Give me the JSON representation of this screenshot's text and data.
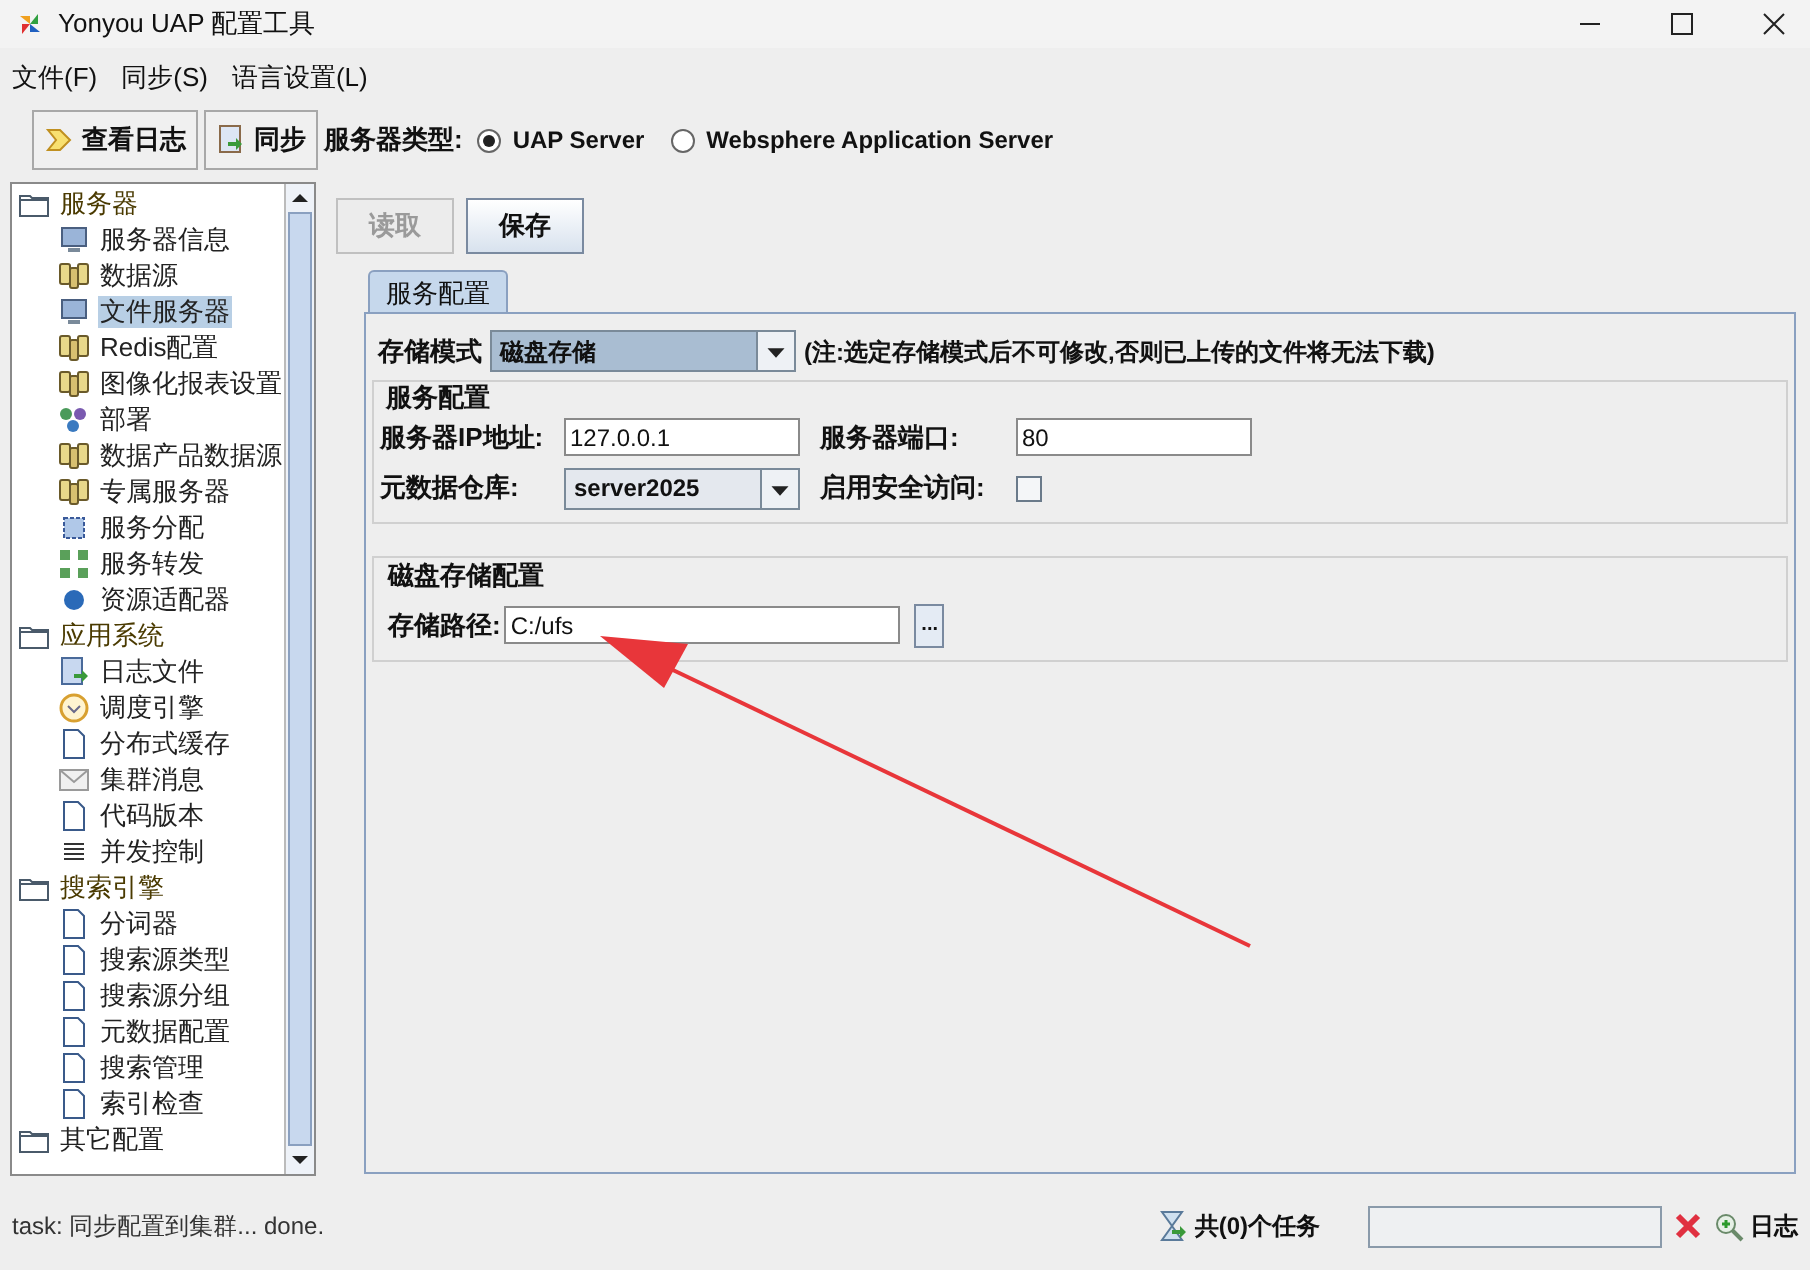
{
  "window": {
    "title": "Yonyou UAP 配置工具"
  },
  "menu": [
    {
      "label": "文件(F)"
    },
    {
      "label": "同步(S)"
    },
    {
      "label": "语言设置(L)"
    }
  ],
  "toolbar": {
    "buttons": [
      {
        "label": "查看日志",
        "kind": "log"
      },
      {
        "label": "同步",
        "kind": "sync"
      }
    ],
    "server_type_label": "服务器类型:",
    "server_types": [
      {
        "label": "UAP Server",
        "selected": true
      },
      {
        "label": "Websphere Application Server",
        "selected": false
      }
    ]
  },
  "tree": [
    {
      "label": "服务器",
      "kind": "folder",
      "selected": false,
      "children": [
        {
          "label": "服务器信息",
          "kind": "monitor",
          "selected": false
        },
        {
          "label": "数据源",
          "kind": "db",
          "selected": false
        },
        {
          "label": "文件服务器",
          "kind": "monitor",
          "selected": true
        },
        {
          "label": "Redis配置",
          "kind": "db",
          "selected": false
        },
        {
          "label": "图像化报表设置",
          "kind": "db",
          "selected": false
        },
        {
          "label": "部署",
          "kind": "people",
          "selected": false
        },
        {
          "label": "数据产品数据源",
          "kind": "db",
          "selected": false
        },
        {
          "label": "专属服务器",
          "kind": "db",
          "selected": false
        },
        {
          "label": "服务分配",
          "kind": "dist",
          "selected": false
        },
        {
          "label": "服务转发",
          "kind": "forward",
          "selected": false
        },
        {
          "label": "资源适配器",
          "kind": "ball",
          "selected": false
        }
      ]
    },
    {
      "label": "应用系统",
      "kind": "folder",
      "selected": false,
      "children": [
        {
          "label": "日志文件",
          "kind": "log",
          "selected": false
        },
        {
          "label": "调度引擎",
          "kind": "clock",
          "selected": false
        },
        {
          "label": "分布式缓存",
          "kind": "doc",
          "selected": false
        },
        {
          "label": "集群消息",
          "kind": "mail",
          "selected": false
        },
        {
          "label": "代码版本",
          "kind": "doc",
          "selected": false
        },
        {
          "label": "并发控制",
          "kind": "lines",
          "selected": false
        }
      ]
    },
    {
      "label": "搜索引擎",
      "kind": "folder",
      "selected": false,
      "children": [
        {
          "label": "分词器",
          "kind": "doc",
          "selected": false
        },
        {
          "label": "搜索源类型",
          "kind": "doc",
          "selected": false
        },
        {
          "label": "搜索源分组",
          "kind": "doc",
          "selected": false
        },
        {
          "label": "元数据配置",
          "kind": "doc",
          "selected": false
        },
        {
          "label": "搜索管理",
          "kind": "doc",
          "selected": false
        },
        {
          "label": "索引检查",
          "kind": "doc",
          "selected": false
        }
      ]
    },
    {
      "label": "其它配置",
      "kind": "folder",
      "selected": false
    }
  ],
  "actions": [
    {
      "label": "读取",
      "disabled": true
    },
    {
      "label": "保存",
      "disabled": false
    }
  ],
  "tabs": [
    {
      "label": "服务配置",
      "selected": true
    }
  ],
  "storage_mode": {
    "label": "存储模式",
    "value": "磁盘存储",
    "note": "(注:选定存储模式后不可修改,否则已上传的文件将无法下载)"
  },
  "service_config": {
    "title": "服务配置",
    "ip_label": "服务器IP地址:",
    "ip_value": "127.0.0.1",
    "port_label": "服务器端口:",
    "port_value": "80",
    "repo_label": "元数据仓库:",
    "repo_value": "server2025",
    "secure_label": "启用安全访问:",
    "secure_checked": false
  },
  "disk_config": {
    "title": "磁盘存储配置",
    "path_label": "存储路径:",
    "path_value": "C:/ufs",
    "browse_label": "..."
  },
  "status_bar": {
    "message": "task: 同步配置到集群... done.",
    "tasks": "共(0)个任务",
    "log_label": "日志"
  }
}
